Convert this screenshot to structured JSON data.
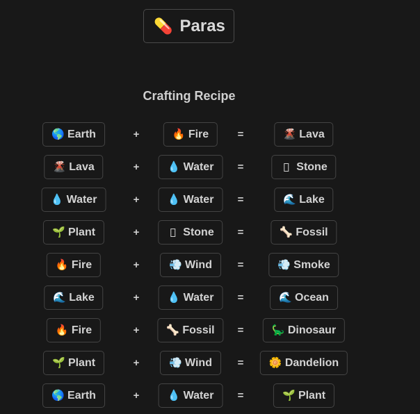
{
  "header": {
    "title": "Paras",
    "icon": "pill-capsule-icon",
    "icon_glyph": "💊"
  },
  "section": {
    "heading": "Crafting Recipe"
  },
  "operators": {
    "plus": "+",
    "equals": "="
  },
  "colors": {
    "background": "#181818",
    "border": "#444444",
    "text": "#d3d3d3"
  },
  "recipes": [
    {
      "a": {
        "label": "Earth",
        "icon": "globe-icon",
        "glyph": "🌎"
      },
      "b": {
        "label": "Fire",
        "icon": "fire-icon",
        "glyph": "🔥"
      },
      "result": {
        "label": "Lava",
        "icon": "volcano-icon",
        "glyph": "🌋"
      }
    },
    {
      "a": {
        "label": "Lava",
        "icon": "volcano-icon",
        "glyph": "🌋"
      },
      "b": {
        "label": "Water",
        "icon": "water-drop-icon",
        "glyph": "💧"
      },
      "result": {
        "label": "Stone",
        "icon": "missing-glyph-icon",
        "glyph": ""
      }
    },
    {
      "a": {
        "label": "Water",
        "icon": "water-drop-icon",
        "glyph": "💧"
      },
      "b": {
        "label": "Water",
        "icon": "water-drop-icon",
        "glyph": "💧"
      },
      "result": {
        "label": "Lake",
        "icon": "wave-icon",
        "glyph": "🌊"
      }
    },
    {
      "a": {
        "label": "Plant",
        "icon": "seedling-icon",
        "glyph": "🌱"
      },
      "b": {
        "label": "Stone",
        "icon": "missing-glyph-icon",
        "glyph": ""
      },
      "result": {
        "label": "Fossil",
        "icon": "bone-icon",
        "glyph": "🦴"
      }
    },
    {
      "a": {
        "label": "Fire",
        "icon": "fire-icon",
        "glyph": "🔥"
      },
      "b": {
        "label": "Wind",
        "icon": "wind-icon",
        "glyph": "💨"
      },
      "result": {
        "label": "Smoke",
        "icon": "wind-icon",
        "glyph": "💨"
      }
    },
    {
      "a": {
        "label": "Lake",
        "icon": "wave-icon",
        "glyph": "🌊"
      },
      "b": {
        "label": "Water",
        "icon": "water-drop-icon",
        "glyph": "💧"
      },
      "result": {
        "label": "Ocean",
        "icon": "wave-icon",
        "glyph": "🌊"
      }
    },
    {
      "a": {
        "label": "Fire",
        "icon": "fire-icon",
        "glyph": "🔥"
      },
      "b": {
        "label": "Fossil",
        "icon": "bone-icon",
        "glyph": "🦴"
      },
      "result": {
        "label": "Dinosaur",
        "icon": "dinosaur-icon",
        "glyph": "🦕"
      }
    },
    {
      "a": {
        "label": "Plant",
        "icon": "seedling-icon",
        "glyph": "🌱"
      },
      "b": {
        "label": "Wind",
        "icon": "wind-icon",
        "glyph": "💨"
      },
      "result": {
        "label": "Dandelion",
        "icon": "flower-icon",
        "glyph": "🌼"
      }
    },
    {
      "a": {
        "label": "Earth",
        "icon": "globe-icon",
        "glyph": "🌎"
      },
      "b": {
        "label": "Water",
        "icon": "water-drop-icon",
        "glyph": "💧"
      },
      "result": {
        "label": "Plant",
        "icon": "seedling-icon",
        "glyph": "🌱"
      }
    }
  ]
}
